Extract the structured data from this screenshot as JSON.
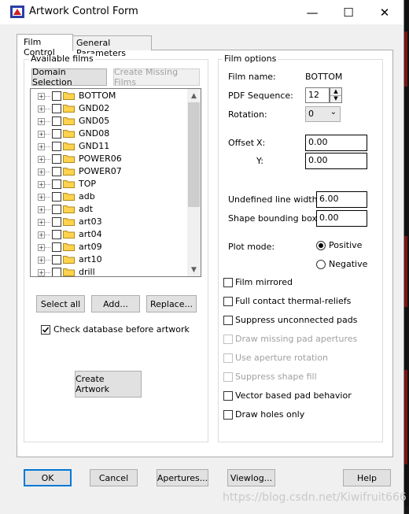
{
  "window": {
    "title": "Artwork Control Form",
    "minimize": "—",
    "maximize": "☐",
    "close": "✕"
  },
  "tabs": [
    {
      "label": "Film Control",
      "active": true
    },
    {
      "label": "General Parameters",
      "active": false
    }
  ],
  "available_films": {
    "group_label": "Available films",
    "domain_selection_label": "Domain Selection",
    "create_missing_label": "Create Missing Films",
    "films": [
      "BOTTOM",
      "GND02",
      "GND05",
      "GND08",
      "GND11",
      "POWER06",
      "POWER07",
      "TOP",
      "adb",
      "adt",
      "art03",
      "art04",
      "art09",
      "art10",
      "drill"
    ],
    "select_all_label": "Select all",
    "add_label": "Add...",
    "replace_label": "Replace...",
    "check_db_label": "Check database before artwork",
    "check_db_checked": true,
    "create_artwork_label": "Create Artwork"
  },
  "film_options": {
    "group_label": "Film options",
    "film_name_label": "Film name:",
    "film_name_value": "BOTTOM",
    "pdf_sequence_label": "PDF Sequence:",
    "pdf_sequence_value": "12",
    "rotation_label": "Rotation:",
    "rotation_value": "0",
    "offset_label": "Offset",
    "offset_x_label": "X:",
    "offset_x_value": "0.00",
    "offset_y_label": "Y:",
    "offset_y_value": "0.00",
    "undefined_line_width_label": "Undefined line width:",
    "undefined_line_width_value": "6.00",
    "shape_bounding_box_label": "Shape bounding box:",
    "shape_bounding_box_value": "0.00",
    "plot_mode_label": "Plot mode:",
    "positive_label": "Positive",
    "negative_label": "Negative",
    "plot_mode_selected": "Positive",
    "checkboxes": [
      {
        "label": "Film mirrored",
        "checked": false,
        "enabled": true
      },
      {
        "label": "Full contact thermal-reliefs",
        "checked": false,
        "enabled": true
      },
      {
        "label": "Suppress unconnected pads",
        "checked": false,
        "enabled": true
      },
      {
        "label": "Draw missing pad apertures",
        "checked": false,
        "enabled": false
      },
      {
        "label": "Use aperture rotation",
        "checked": false,
        "enabled": false
      },
      {
        "label": "Suppress shape fill",
        "checked": false,
        "enabled": false
      },
      {
        "label": "Vector based pad behavior",
        "checked": false,
        "enabled": true
      },
      {
        "label": "Draw holes only",
        "checked": false,
        "enabled": true
      }
    ]
  },
  "footer": {
    "ok": "OK",
    "cancel": "Cancel",
    "apertures": "Apertures...",
    "viewlog": "Viewlog...",
    "help": "Help"
  },
  "watermark": "https://blog.csdn.net/Kiwifruit666",
  "colors": {
    "accent": "#0078d7",
    "folder": "#ffd34d"
  }
}
